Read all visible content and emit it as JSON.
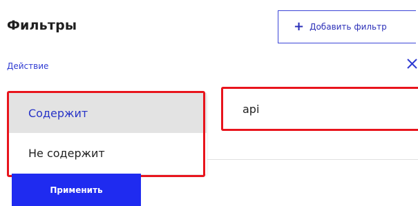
{
  "header": {
    "title": "Фильтры",
    "add_filter_label": "Добавить фильтр",
    "add_icon": "plus-icon"
  },
  "filter": {
    "field_label": "Действие",
    "remove_icon": "close-icon",
    "operator_options": [
      {
        "label": "Содержит",
        "selected": true
      },
      {
        "label": "Не содержит",
        "selected": false
      }
    ],
    "value": "api"
  },
  "footer": {
    "apply_label": "Применить"
  },
  "colors": {
    "accent": "#1f2bf0",
    "link": "#2f3bd2",
    "highlight": "#e8141c",
    "selected_bg": "#e3e3e3"
  }
}
